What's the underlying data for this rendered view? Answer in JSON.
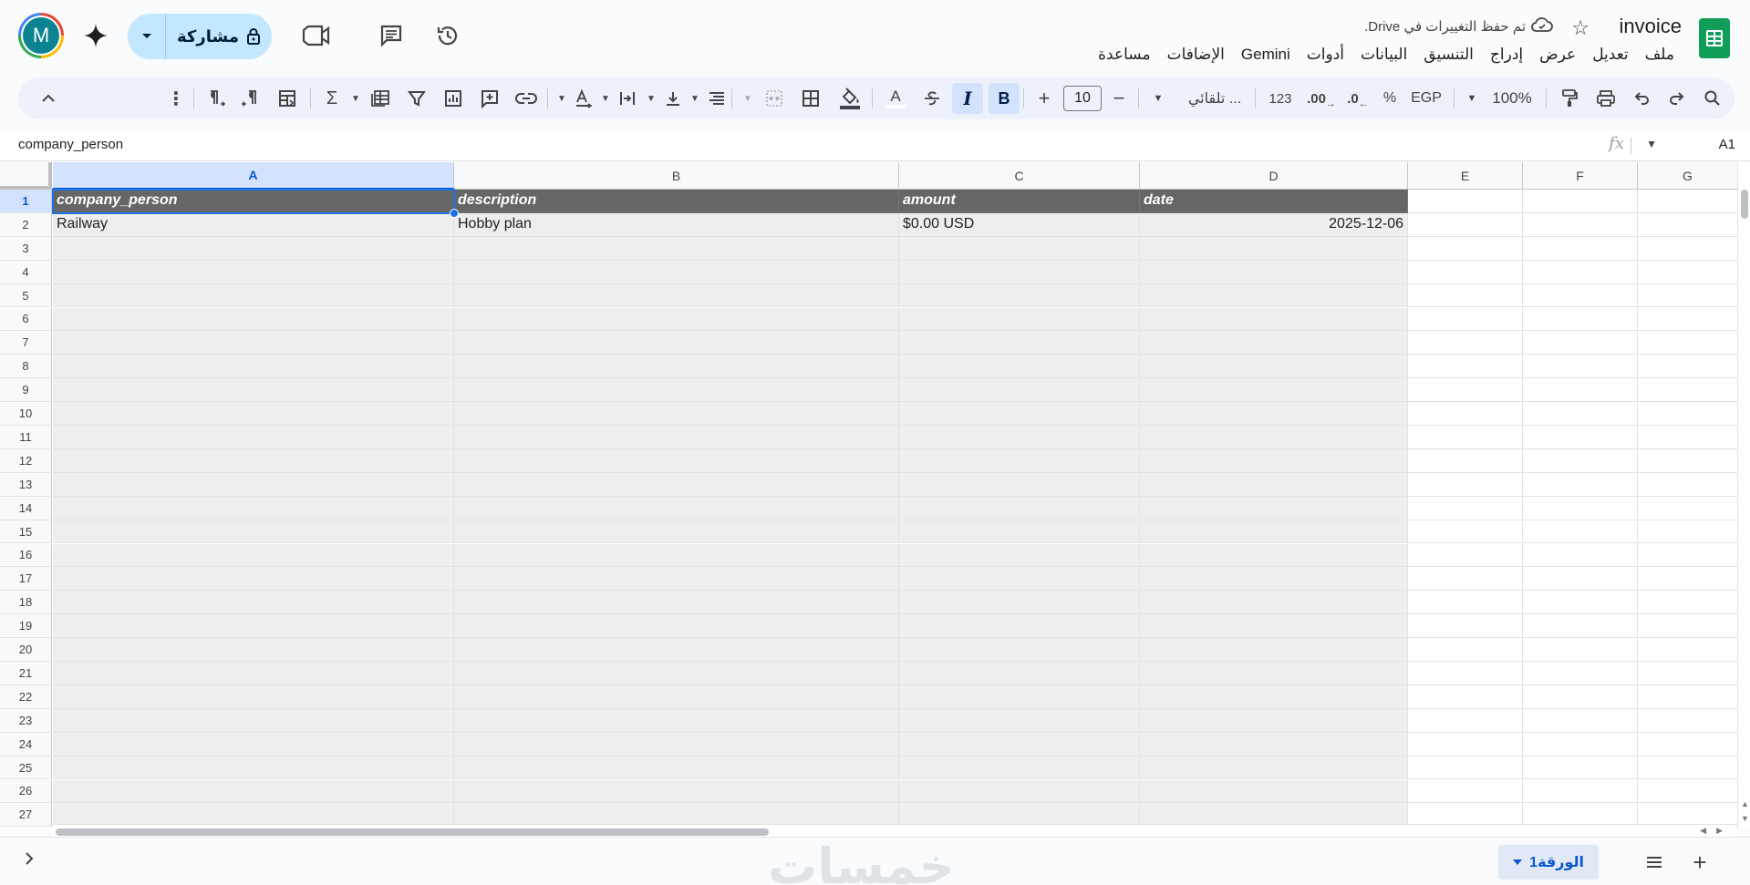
{
  "header": {
    "doc_title": "invoice",
    "save_status": "تم حفظ التغييرات في Drive.",
    "share_label": "مشاركة",
    "avatar_letter": "M",
    "menu": [
      "ملف",
      "تعديل",
      "عرض",
      "إدراج",
      "التنسيق",
      "البيانات",
      "أدوات",
      "Gemini",
      "الإضافات",
      "مساعدة"
    ]
  },
  "toolbar": {
    "zoom": "100%",
    "currency": "EGP",
    "percent": "%",
    "decrease_decimal": ".0",
    "increase_decimal": ".00",
    "number_format": "123",
    "font": "تلقائي ...",
    "font_size": "10",
    "bold": "B",
    "italic": "I",
    "text_color": "A"
  },
  "formula_bar": {
    "cell_ref": "A1",
    "fx": "fx",
    "content": "company_person"
  },
  "grid": {
    "columns": [
      "A",
      "B",
      "C",
      "D",
      "E",
      "F",
      "G"
    ],
    "header_row": [
      "company_person",
      "description",
      "amount",
      "date"
    ],
    "data_rows": [
      [
        "Railway",
        "Hobby plan",
        "$0.00 USD",
        "2025-12-06"
      ]
    ],
    "row_count": 27
  },
  "bottom": {
    "sheet_name": "الورقة1",
    "watermark": "خمسات"
  },
  "colors": {
    "accent": "#1a73e8",
    "header_fill": "#666666",
    "band_fill": "#eeeeee",
    "share_bg": "#c2e7ff",
    "sheets_green": "#0f9d58"
  }
}
